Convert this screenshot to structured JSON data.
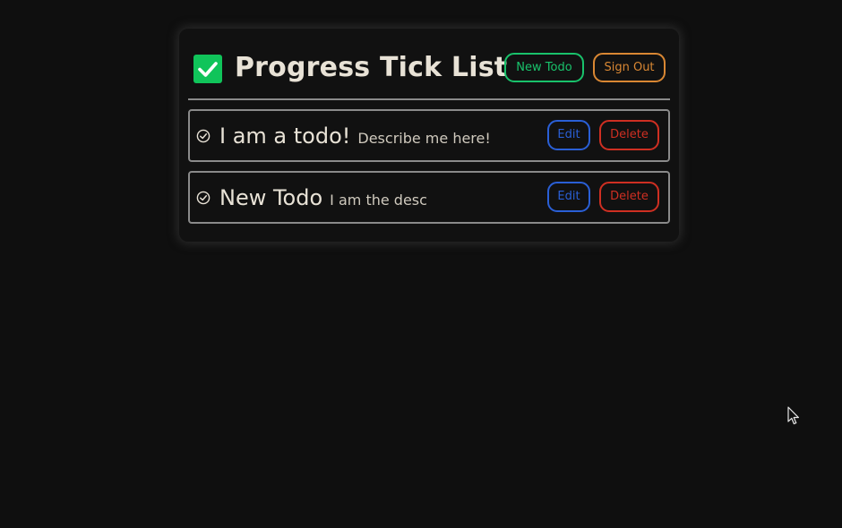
{
  "header": {
    "logo_icon": "check-square-icon",
    "title": "Progress Tick List",
    "new_todo_label": "New Todo",
    "sign_out_label": "Sign Out"
  },
  "todos": [
    {
      "title": "I am a todo!",
      "description": "Describe me here!",
      "status_icon": "check-circle-icon",
      "edit_label": "Edit",
      "delete_label": "Delete"
    },
    {
      "title": "New Todo",
      "description": "I am the desc",
      "status_icon": "check-circle-icon",
      "edit_label": "Edit",
      "delete_label": "Delete"
    }
  ],
  "colors": {
    "background": "#0f0f0f",
    "card": "#111111",
    "text": "#e8e2d6",
    "logo": "#10c45a",
    "new_todo": "#19c26b",
    "sign_out": "#d98733",
    "edit": "#2a5fd6",
    "delete": "#cf2f22",
    "border": "#8a8a8a"
  }
}
